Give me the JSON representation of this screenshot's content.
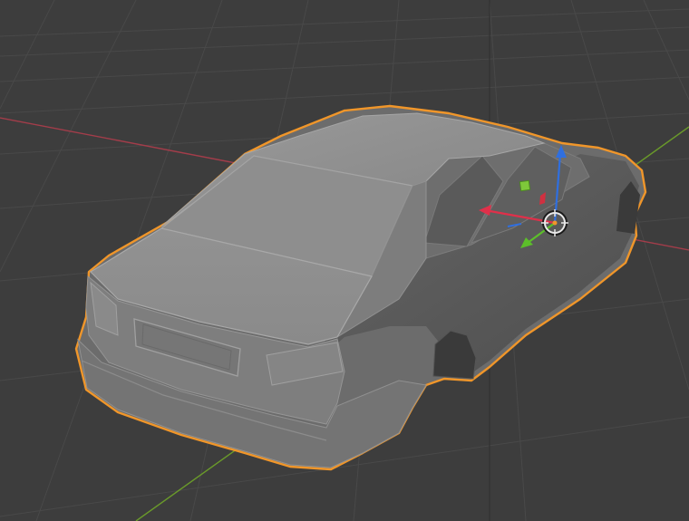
{
  "viewport": {
    "background": "#3d3d3d",
    "grid_color": "#4a4a4a",
    "x_axis_color": "#a33d4a",
    "y_axis_color": "#6a9a2a",
    "selection_outline_color": "#f0962a"
  },
  "object": {
    "kind": "car-body-mesh",
    "selected": true
  },
  "gizmo": {
    "x_arrow_color": "#e0304a",
    "y_arrow_color": "#5cbf2a",
    "z_arrow_color": "#2f6fe0",
    "plane_handle_color": "#7ec83a",
    "origin_icon": "crosshair-circle-icon"
  }
}
